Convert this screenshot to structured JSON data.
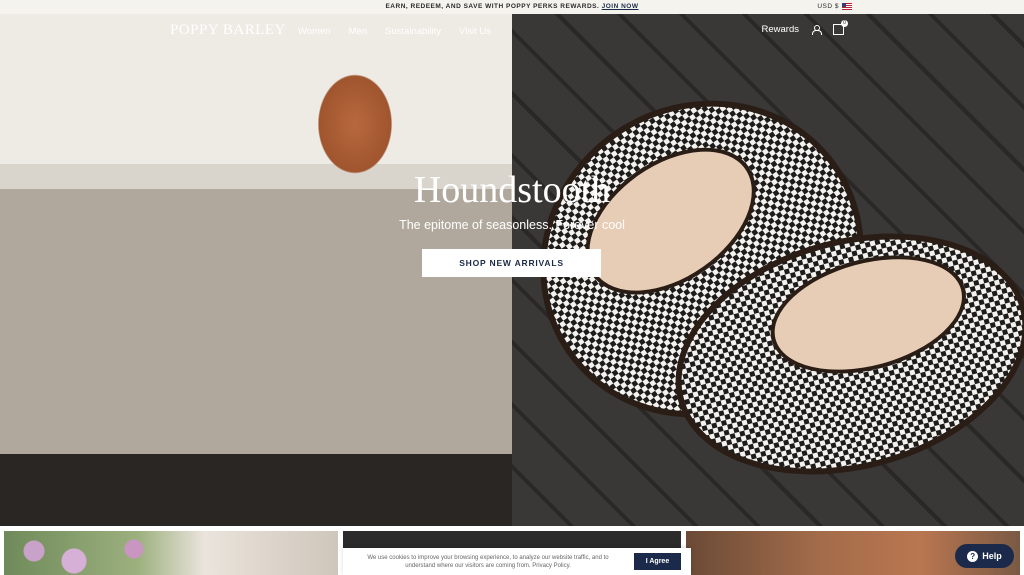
{
  "announcement": {
    "text": "EARN, REDEEM, AND SAVE WITH POPPY PERKS REWARDS.",
    "link": "JOIN NOW",
    "currency": "USD $"
  },
  "nav": {
    "logo": "POPPY BARLEY",
    "links": [
      "Women",
      "Men",
      "Sustainability",
      "Visit Us"
    ],
    "rewards": "Rewards",
    "cart_count": "0"
  },
  "hero": {
    "title": "Houndstooth",
    "subtitle": "The epitome of seasonless. Forever cool",
    "cta": "SHOP NEW ARRIVALS"
  },
  "cookie": {
    "text": "We use cookies to improve your browsing experience, to analyze our website traffic, and to understand where our visitors are coming from. Privacy Policy.",
    "button": "I Agree"
  },
  "help": {
    "label": "Help"
  }
}
